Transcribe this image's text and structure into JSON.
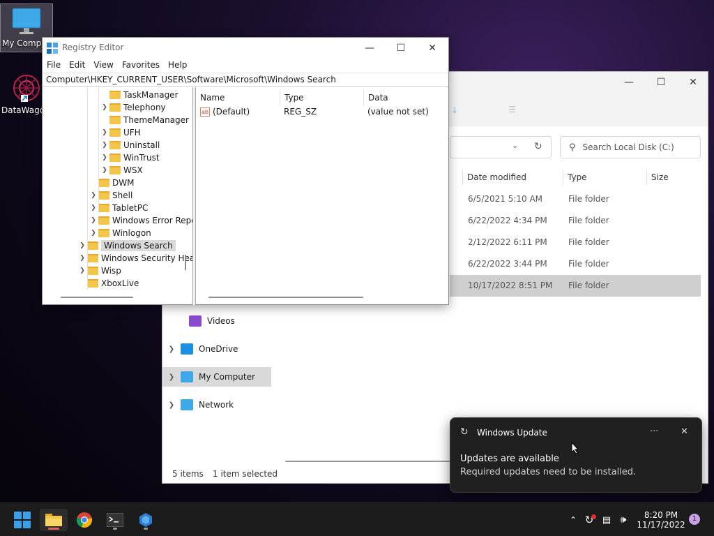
{
  "desktop": {
    "icons": [
      {
        "label": "My Computer",
        "name": "my-computer"
      },
      {
        "label": "DataWagon",
        "name": "datawagon"
      }
    ]
  },
  "regedit": {
    "title": "Registry Editor",
    "menu": [
      "File",
      "Edit",
      "View",
      "Favorites",
      "Help"
    ],
    "path": "Computer\\HKEY_CURRENT_USER\\Software\\Microsoft\\Windows Search",
    "tree": [
      {
        "label": "TaskManager",
        "has_children": false
      },
      {
        "label": "Telephony",
        "has_children": true
      },
      {
        "label": "ThemeManager",
        "has_children": false
      },
      {
        "label": "UFH",
        "has_children": true
      },
      {
        "label": "Uninstall",
        "has_children": true
      },
      {
        "label": "WinTrust",
        "has_children": true
      },
      {
        "label": "WSX",
        "has_children": true
      },
      {
        "label": "DWM",
        "has_children": false
      },
      {
        "label": "Shell",
        "has_children": true
      },
      {
        "label": "TabletPC",
        "has_children": true
      },
      {
        "label": "Windows Error Reporting",
        "has_children": true
      },
      {
        "label": "Winlogon",
        "has_children": true
      },
      {
        "label": "Windows Search",
        "has_children": true,
        "selected": true
      },
      {
        "label": "Windows Security Health",
        "has_children": true
      },
      {
        "label": "Wisp",
        "has_children": true
      },
      {
        "label": "XboxLive",
        "has_children": false
      }
    ],
    "columns": [
      "Name",
      "Type",
      "Data"
    ],
    "values": [
      {
        "name": "(Default)",
        "type": "REG_SZ",
        "data": "(value not set)"
      }
    ]
  },
  "explorer": {
    "search_placeholder": "Search Local Disk (C:)",
    "columns": [
      "Date modified",
      "Type",
      "Size"
    ],
    "rows": [
      {
        "date": "6/5/2021 5:10 AM",
        "type": "File folder"
      },
      {
        "date": "6/22/2022 4:34 PM",
        "type": "File folder"
      },
      {
        "date": "2/12/2022 6:11 PM",
        "type": "File folder"
      },
      {
        "date": "6/22/2022 3:44 PM",
        "type": "File folder"
      },
      {
        "date": "10/17/2022 8:51 PM",
        "type": "File folder",
        "selected": true
      }
    ],
    "nav": [
      {
        "label": "Videos",
        "icon": "videos-icon",
        "has_children": false
      },
      {
        "label": "OneDrive",
        "icon": "onedrive-icon",
        "has_children": true
      },
      {
        "label": "My Computer",
        "icon": "computer-icon",
        "has_children": true,
        "selected": true
      },
      {
        "label": "Network",
        "icon": "network-icon",
        "has_children": true
      }
    ],
    "status_items": "5 items",
    "status_selected": "1 item selected"
  },
  "toast": {
    "app": "Windows Update",
    "heading": "Updates are available",
    "body": "Required updates need to be installed."
  },
  "taskbar": {
    "time": "8:20 PM",
    "date": "11/17/2022",
    "notification_count": "1",
    "apps": [
      "start-button",
      "file-explorer",
      "chrome",
      "terminal",
      "app-icon"
    ]
  },
  "colors": {
    "folder": "#f3c54a",
    "accent": "#0078d4",
    "taskbar": "#1c1c1c",
    "toast_bg": "#202020"
  }
}
